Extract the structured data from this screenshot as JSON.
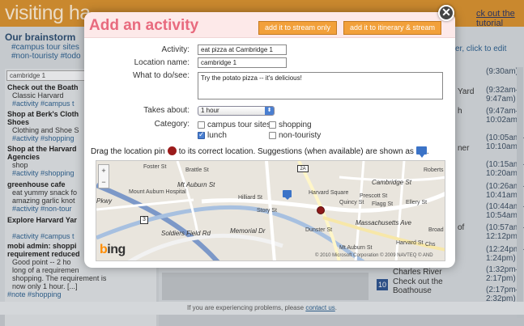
{
  "app": {
    "brand": "visiting ha",
    "tutorial_link": "ck out the tutorial",
    "footer_prefix": "If you are experiencing problems, please",
    "footer_link": "contact us",
    "footer_suffix": "."
  },
  "brainstorm": {
    "title": "Our brainstorm",
    "tags_line1": "#campus tour sites",
    "tags_line2": "#non-touristy  #todo",
    "click_edit": "er, click to edit",
    "search_value": "cambridge 1",
    "items": [
      {
        "title": "Check out the Boath",
        "body": "Classic Harvard",
        "tags": "#activity  #campus t"
      },
      {
        "title": "Shop at Berk's Cloth",
        "title2": "Shoes",
        "body": "Clothing and Shoe S",
        "tags": "#activity  #shopping"
      },
      {
        "title": "Shop at the Harvard",
        "title2": "Agencies",
        "body": "shop",
        "tags": "#activity  #shopping"
      },
      {
        "title": "greenhouse cafe",
        "body": "eat yummy snack fo",
        "body2": "amazing garlic knot",
        "tags": "#activity  #non-tour"
      },
      {
        "title": "Explore Harvard Yar",
        "body": "",
        "tags": "#activity  #campus t"
      },
      {
        "title": "mobi admin: shoppi",
        "title2": "requirement reduced",
        "body": "Good point -- 2 ho",
        "body2": "long of a requiremen",
        "body3": "shopping. The requirement is",
        "body4": "now only 1 hour. [...]",
        "tags": "#note  #shopping"
      }
    ]
  },
  "itinerary": {
    "times": [
      "(9:30am)",
      "(9:32am–\n9:47am)",
      "(9:47am–\n10:02am)",
      "(10:05am–\n10:10am)",
      "(10:15am–\n10:20am)",
      "(10:26am–\n10:41am)",
      "(10:44am–\n10:54am)",
      "(10:57am–\n12:12pm)",
      "(12:24pm–\n1:24pm)",
      "(1:32pm–\n2:17pm)",
      "(2:17pm–\n2:32pm)"
    ],
    "side_words": [
      "Yard",
      "h",
      "ner",
      "of"
    ],
    "charles": "Charles River",
    "stop_number": "10",
    "stop_name_line1": "Check out the",
    "stop_name_line2": "Boathouse"
  },
  "modal": {
    "title": "Add an activity",
    "btn_stream": "add it to stream only",
    "btn_itinerary": "add it to itinerary & stream",
    "close_glyph": "✕",
    "fields": {
      "activity_label": "Activity:",
      "activity_value": "eat pizza at Cambridge 1",
      "location_label": "Location name:",
      "location_value": "cambridge 1",
      "todo_label": "What to do/see:",
      "todo_value": "Try the potato pizza -- it's delicious!",
      "takes_label": "Takes about:",
      "takes_value": "1 hour",
      "category_label": "Category:"
    },
    "categories": [
      {
        "label": "campus tour sites",
        "checked": false
      },
      {
        "label": "shopping",
        "checked": false
      },
      {
        "label": "lunch",
        "checked": true
      },
      {
        "label": "non-touristy",
        "checked": false
      }
    ],
    "drag_text_1": "Drag the location pin",
    "drag_text_2": "to its correct location. Suggestions (when available) are shown as",
    "drag_text_3": ".",
    "map": {
      "labels": [
        "Foster St",
        "Brattle St",
        "Mt Auburn St",
        "Mount Auburn Hospital",
        "Cambridge St",
        "Harvard Square",
        "Hilliard St",
        "Story St",
        "Quincy St",
        "Prescott St",
        "Ellery St",
        "Massachusetts Ave",
        "Harvard St",
        "Dunster St",
        "Mt Auburn St",
        "Soldiers Field Rd",
        "Memorial Dr",
        "Flagg St",
        "Roberts",
        "Chs",
        "Broad",
        "Pkwy"
      ],
      "route_1": "3",
      "route_2": "2A",
      "zoom_in": "+",
      "zoom_out": "−",
      "bing_b": "b",
      "bing_rest": "ing",
      "copyright": "© 2010 Microsoft Corporation  © 2009 NAVTEQ  © AND"
    }
  }
}
